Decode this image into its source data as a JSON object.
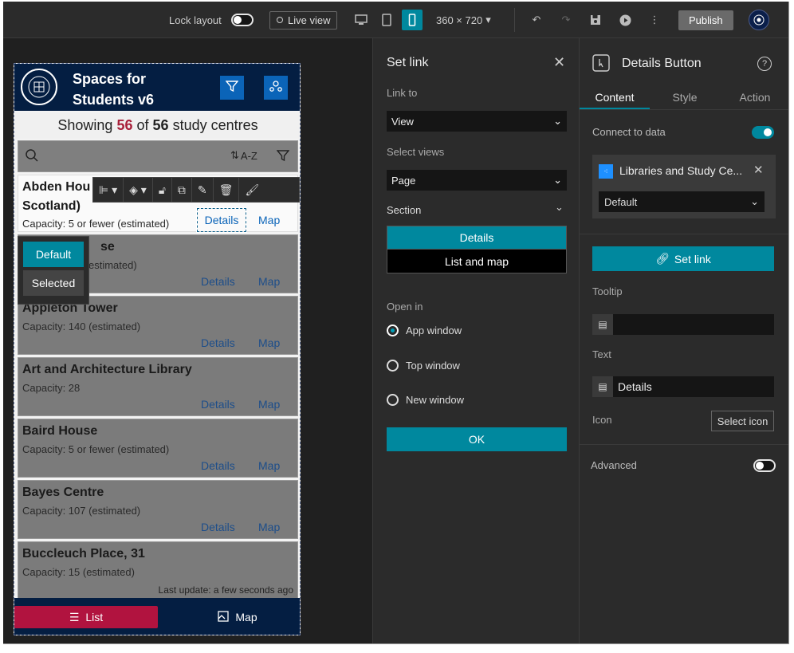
{
  "topbar": {
    "lock_layout_label": "Lock layout",
    "live_view_label": "Live view",
    "device_size": "360 × 720",
    "publish_label": "Publish"
  },
  "app": {
    "title": "Spaces for Students v6",
    "showing_prefix": "Showing",
    "showing_count": "56",
    "showing_of": "of",
    "showing_total": "56",
    "showing_suffix": "study centres",
    "sort_label": "A-Z",
    "cards": [
      {
        "name": "Abden House (Scotland)",
        "capacity": "Capacity: 5 or fewer (estimated)"
      },
      {
        "name": "Alison House",
        "capacity": "Capacity: 5 (estimated)"
      },
      {
        "name": "Appleton Tower",
        "capacity": "Capacity: 140 (estimated)"
      },
      {
        "name": "Art and Architecture Library",
        "capacity": "Capacity: 28"
      },
      {
        "name": "Baird House",
        "capacity": "Capacity: 5 or fewer (estimated)"
      },
      {
        "name": "Bayes Centre",
        "capacity": "Capacity: 107 (estimated)"
      },
      {
        "name": "Buccleuch Place, 31",
        "capacity": "Capacity: 15 (estimated)"
      }
    ],
    "card_title_0a": "Abden Hou",
    "card_title_0b": "Scotland)",
    "card_title_1": "se",
    "card_capacity_1": "estimated)",
    "details_label": "Details",
    "map_label": "Map",
    "state_default": "Default",
    "state_selected": "Selected",
    "last_update": "Last update: a few seconds ago",
    "footer_list": "List",
    "footer_map": "Map"
  },
  "setlink": {
    "title": "Set link",
    "link_to_label": "Link to",
    "link_to_value": "View",
    "select_views_label": "Select views",
    "select_views_value": "Page",
    "section_label": "Section",
    "sections": [
      "Details",
      "List and map"
    ],
    "open_in_label": "Open in",
    "open_options": [
      "App window",
      "Top window",
      "New window"
    ],
    "ok_label": "OK"
  },
  "rpanel": {
    "title": "Details Button",
    "tabs": [
      "Content",
      "Style",
      "Action"
    ],
    "connect_label": "Connect to data",
    "datasource_name": "Libraries and Study Ce...",
    "datasource_view": "Default",
    "set_link_label": "Set link",
    "tooltip_label": "Tooltip",
    "tooltip_value": "",
    "text_label": "Text",
    "text_value": "Details",
    "icon_label": "Icon",
    "select_icon_label": "Select icon",
    "advanced_label": "Advanced"
  },
  "colors": {
    "accent": "#00889e",
    "header": "#041e42",
    "list_button": "#b1133f",
    "count_red": "#a8203a"
  }
}
